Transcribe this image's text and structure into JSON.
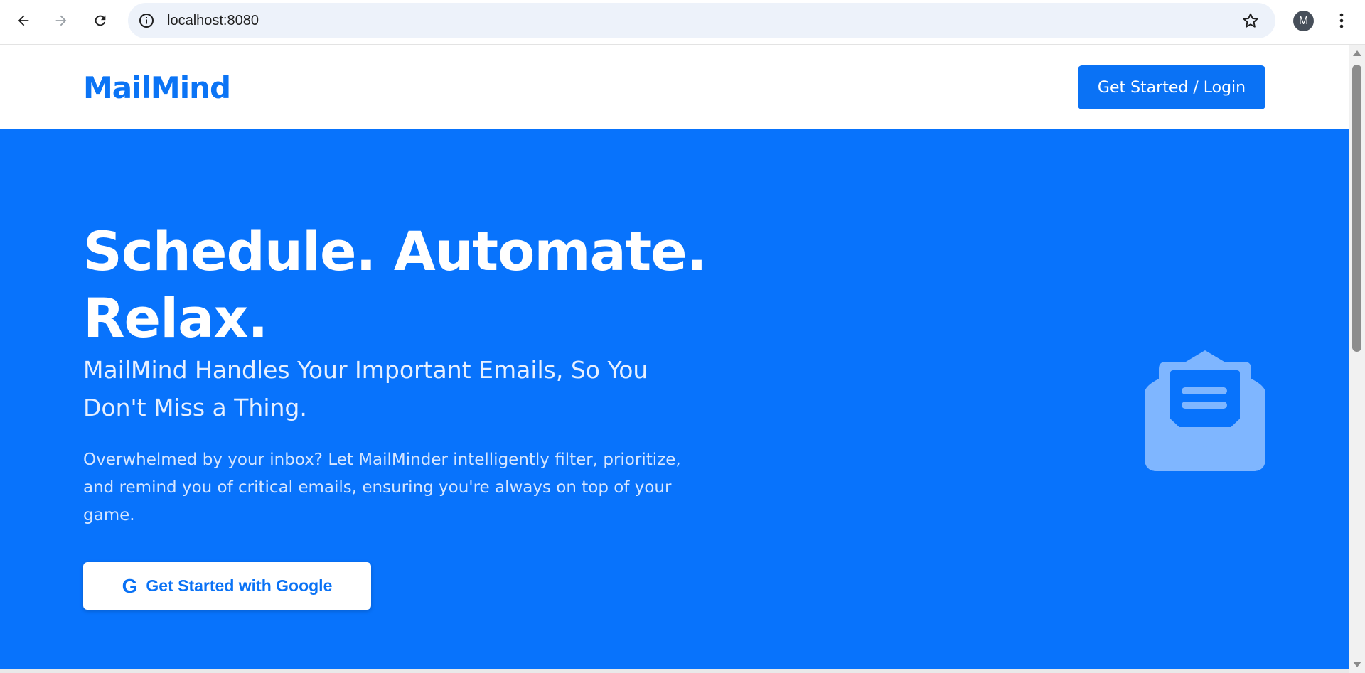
{
  "browser": {
    "url": "localhost:8080",
    "profile_initial": "M",
    "icons": [
      "back-arrow-icon",
      "forward-arrow-icon",
      "reload-icon",
      "site-info-icon",
      "bookmark-star-icon",
      "kebab-menu-icon"
    ]
  },
  "header": {
    "logo": "MailMind",
    "cta_label": "Get Started / Login"
  },
  "hero": {
    "title_line1": "Schedule. Automate.",
    "title_line2": "Relax.",
    "subtitle": "MailMind Handles Your Important Emails, So You Don't Miss a Thing.",
    "description": "Overwhelmed by your inbox? Let MailMinder intelligently filter, prioritize, and remind you of critical emails, ensuring you're always on top of your game.",
    "google_button_label": "Get Started with Google",
    "google_icon_glyph": "G"
  },
  "colors": {
    "brand_blue": "#0873fc",
    "button_blue": "#0a72f5",
    "envelope_tint": "#7fb6ff"
  }
}
